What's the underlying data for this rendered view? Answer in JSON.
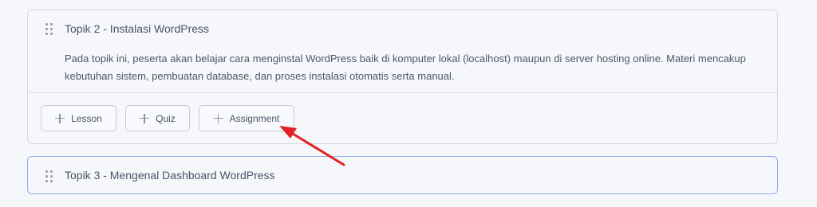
{
  "topics": [
    {
      "title": "Topik 2 - Instalasi WordPress",
      "description": "Pada topik ini, peserta akan belajar cara menginstal WordPress baik di komputer lokal (localhost) maupun di server hosting online. Materi mencakup kebutuhan sistem, pembuatan database, dan proses instalasi otomatis serta manual.",
      "buttons": {
        "lesson": "Lesson",
        "quiz": "Quiz",
        "assignment": "Assignment"
      },
      "expanded": true
    },
    {
      "title": "Topik 3 - Mengenal Dashboard WordPress",
      "expanded": false,
      "focused": true
    }
  ],
  "colors": {
    "annotation_arrow": "#e02424",
    "focus_border": "#8faef0"
  },
  "icons": {
    "drag": "drag-handle-icon",
    "add": "plus-icon"
  }
}
